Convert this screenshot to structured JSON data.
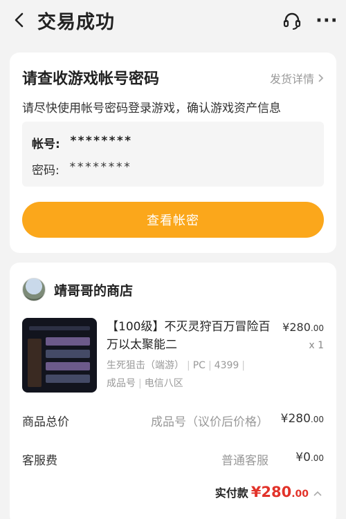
{
  "header": {
    "title": "交易成功",
    "back_icon": "chevron-left-icon",
    "support_icon": "headset-icon",
    "more_icon": "more-dots-icon",
    "more_glyph": "···"
  },
  "account_card": {
    "title": "请查收游戏帐号密码",
    "delivery_link": "发货详情",
    "description": "请尽快使用帐号密码登录游戏，确认游戏资产信息",
    "account_label": "帐号:",
    "account_value": "********",
    "password_label": "密码:",
    "password_value": "********",
    "view_button": "查看帐密",
    "button_color": "#fba71b"
  },
  "order_card": {
    "shop_name": "靖哥哥的商店",
    "product": {
      "title": "【100级】不灭灵狩百万冒险百万以太聚能二",
      "price_symbol": "¥",
      "price_int": "280",
      "price_dec": ".00",
      "quantity": "x 1",
      "tags": [
        "生死狙击（端游）",
        "PC",
        "4399",
        "成品号",
        "电信八区"
      ]
    },
    "rows": [
      {
        "label": "商品总价",
        "note": "成品号（议价后价格）",
        "symbol": "¥",
        "int": "280",
        "dec": ".00"
      },
      {
        "label": "客服费",
        "note": "普通客服",
        "symbol": "¥",
        "int": "0",
        "dec": ".00"
      }
    ],
    "total": {
      "label": "实付款",
      "symbol": "¥",
      "int": "280",
      "dec": ".00",
      "color": "#e2332a"
    }
  }
}
